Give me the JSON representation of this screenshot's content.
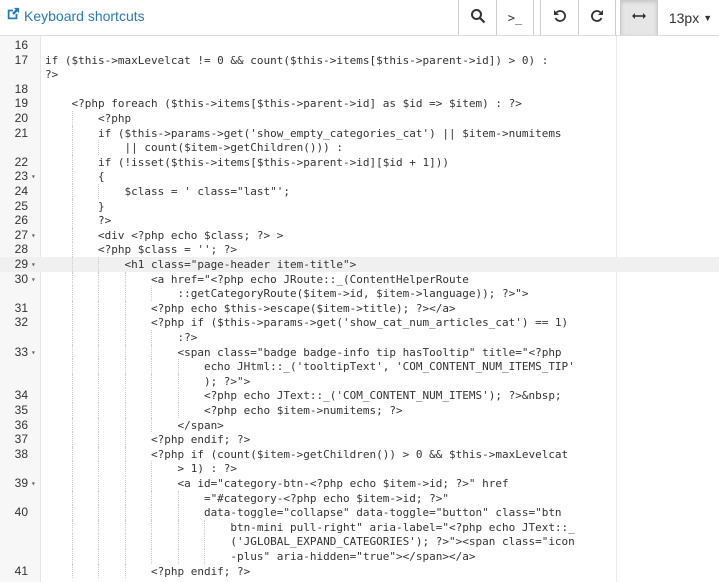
{
  "toolbar": {
    "keyboard_shortcuts_label": "Keyboard shortcuts",
    "font_size": "13px",
    "prompt_glyph": ">_"
  },
  "colors": {
    "link": "#2a7ab0",
    "active_button_bg": "#e6e6e6",
    "keyword": "#0000a0",
    "variable": "#318495"
  },
  "icons": {
    "external": "external-link-icon",
    "search": "search-icon",
    "console": "console-icon",
    "undo": "undo-icon",
    "redo": "redo-icon",
    "wrap": "horizontal-arrows-icon",
    "caret": "caret-down-icon"
  },
  "editor": {
    "highlighted_line": "29",
    "lines": [
      {
        "n": "16",
        "fold": false,
        "text": ""
      },
      {
        "n": "17",
        "fold": false,
        "text": "if ($this->maxLevelcat != 0 && count($this->items[$this->parent->id]) > 0) :"
      },
      {
        "n": "",
        "fold": false,
        "text": "?>"
      },
      {
        "n": "18",
        "fold": false,
        "text": ""
      },
      {
        "n": "19",
        "fold": false,
        "text": "    <?php foreach ($this->items[$this->parent->id] as $id => $item) : ?>"
      },
      {
        "n": "20",
        "fold": false,
        "text": "        <?php"
      },
      {
        "n": "21",
        "fold": false,
        "text": "        if ($this->params->get('show_empty_categories_cat') || $item->numitems"
      },
      {
        "n": "",
        "fold": false,
        "text": "            || count($item->getChildren())) :"
      },
      {
        "n": "22",
        "fold": false,
        "text": "        if (!isset($this->items[$this->parent->id][$id + 1]))"
      },
      {
        "n": "23",
        "fold": true,
        "text": "        {"
      },
      {
        "n": "24",
        "fold": false,
        "text": "            $class = ' class=\"last\"';"
      },
      {
        "n": "25",
        "fold": false,
        "text": "        }"
      },
      {
        "n": "26",
        "fold": false,
        "text": "        ?>"
      },
      {
        "n": "27",
        "fold": true,
        "text": "        <div <?php echo $class; ?> >"
      },
      {
        "n": "28",
        "fold": false,
        "text": "        <?php $class = ''; ?>"
      },
      {
        "n": "29",
        "fold": true,
        "text": "            <h1 class=\"page-header item-title\">"
      },
      {
        "n": "30",
        "fold": true,
        "text": "                <a href=\"<?php echo JRoute::_(ContentHelperRoute"
      },
      {
        "n": "",
        "fold": false,
        "text": "                    ::getCategoryRoute($item->id, $item->language)); ?>\">"
      },
      {
        "n": "31",
        "fold": false,
        "text": "                <?php echo $this->escape($item->title); ?></a>"
      },
      {
        "n": "32",
        "fold": false,
        "text": "                <?php if ($this->params->get('show_cat_num_articles_cat') == 1)"
      },
      {
        "n": "",
        "fold": false,
        "text": "                    :?>"
      },
      {
        "n": "33",
        "fold": true,
        "text": "                    <span class=\"badge badge-info tip hasTooltip\" title=\"<?php"
      },
      {
        "n": "",
        "fold": false,
        "text": "                        echo JHtml::_('tooltipText', 'COM_CONTENT_NUM_ITEMS_TIP'"
      },
      {
        "n": "",
        "fold": false,
        "text": "                        ); ?>\">"
      },
      {
        "n": "34",
        "fold": false,
        "text": "                        <?php echo JText::_('COM_CONTENT_NUM_ITEMS'); ?>&nbsp;"
      },
      {
        "n": "35",
        "fold": false,
        "text": "                        <?php echo $item->numitems; ?>"
      },
      {
        "n": "36",
        "fold": false,
        "text": "                    </span>"
      },
      {
        "n": "37",
        "fold": false,
        "text": "                <?php endif; ?>"
      },
      {
        "n": "38",
        "fold": false,
        "text": "                <?php if (count($item->getChildren()) > 0 && $this->maxLevelcat"
      },
      {
        "n": "",
        "fold": false,
        "text": "                    > 1) : ?>"
      },
      {
        "n": "39",
        "fold": true,
        "text": "                    <a id=\"category-btn-<?php echo $item->id; ?>\" href"
      },
      {
        "n": "",
        "fold": false,
        "text": "                        =\"#category-<?php echo $item->id; ?>\""
      },
      {
        "n": "40",
        "fold": false,
        "text": "                        data-toggle=\"collapse\" data-toggle=\"button\" class=\"btn"
      },
      {
        "n": "",
        "fold": false,
        "text": "                            btn-mini pull-right\" aria-label=\"<?php echo JText::_"
      },
      {
        "n": "",
        "fold": false,
        "text": "                            ('JGLOBAL_EXPAND_CATEGORIES'); ?>\"><span class=\"icon"
      },
      {
        "n": "",
        "fold": false,
        "text": "                            -plus\" aria-hidden=\"true\"></span></a>"
      },
      {
        "n": "41",
        "fold": false,
        "text": "                <?php endif; ?>"
      }
    ]
  }
}
